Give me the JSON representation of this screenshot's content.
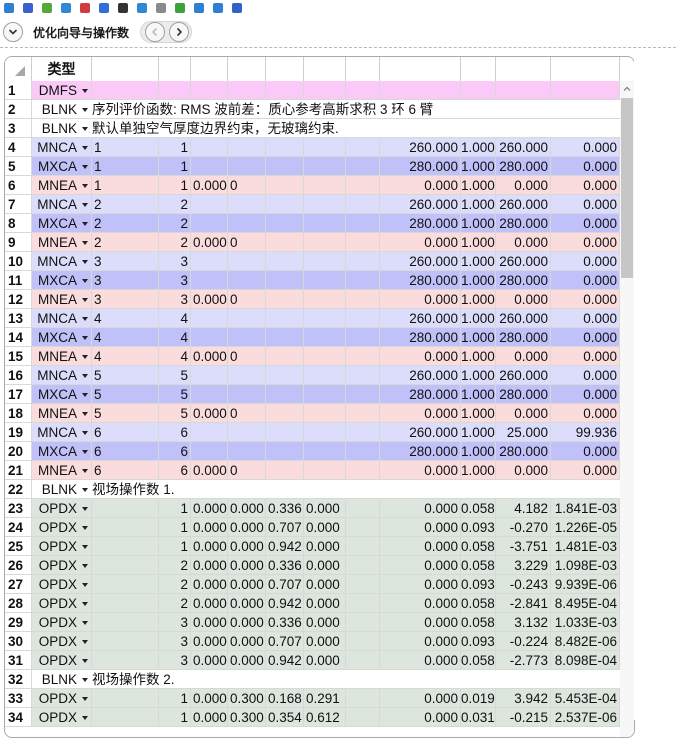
{
  "navbar": {
    "title": "优化向导与操作数"
  },
  "toolbar": {
    "icons": [
      "refresh-icon",
      "save-icon",
      "load-icon",
      "insert-icon",
      "delete-icon",
      "wizard-icon",
      "select-icon",
      "undo-icon",
      "toggle-icon",
      "sort-icon",
      "expand-icon",
      "arrow-icon",
      "help-icon"
    ]
  },
  "grid": {
    "header_type": "类型",
    "colors": {
      "DMFS": "#fbc9f7",
      "BLNK": "#ffffff",
      "MNCA": "#dcdcfb",
      "MXCA": "#c1c1f9",
      "MNEA": "#fadcdc",
      "OPDX": "#dde6dc"
    },
    "rows": [
      {
        "n": "1",
        "type": "DMFS",
        "c": [
          "",
          "",
          "",
          "",
          "",
          "",
          "",
          "",
          "",
          ""
        ]
      },
      {
        "n": "2",
        "type": "BLNK",
        "comment": "序列评价函数: RMS 波前差：质心参考高斯求积 3 环 6 臂"
      },
      {
        "n": "3",
        "type": "BLNK",
        "comment": "默认单独空气厚度边界约束，无玻璃约束."
      },
      {
        "n": "4",
        "type": "MNCA",
        "c": [
          "1",
          "1",
          "",
          "",
          "",
          "",
          "260.000",
          "1.000",
          "260.000",
          "0.000"
        ]
      },
      {
        "n": "5",
        "type": "MXCA",
        "c": [
          "1",
          "1",
          "",
          "",
          "",
          "",
          "280.000",
          "1.000",
          "280.000",
          "0.000"
        ]
      },
      {
        "n": "6",
        "type": "MNEA",
        "c": [
          "1",
          "1",
          "0.000",
          "0",
          "",
          "",
          "0.000",
          "1.000",
          "0.000",
          "0.000"
        ]
      },
      {
        "n": "7",
        "type": "MNCA",
        "c": [
          "2",
          "2",
          "",
          "",
          "",
          "",
          "260.000",
          "1.000",
          "260.000",
          "0.000"
        ]
      },
      {
        "n": "8",
        "type": "MXCA",
        "c": [
          "2",
          "2",
          "",
          "",
          "",
          "",
          "280.000",
          "1.000",
          "280.000",
          "0.000"
        ]
      },
      {
        "n": "9",
        "type": "MNEA",
        "c": [
          "2",
          "2",
          "0.000",
          "0",
          "",
          "",
          "0.000",
          "1.000",
          "0.000",
          "0.000"
        ]
      },
      {
        "n": "10",
        "type": "MNCA",
        "c": [
          "3",
          "3",
          "",
          "",
          "",
          "",
          "260.000",
          "1.000",
          "260.000",
          "0.000"
        ]
      },
      {
        "n": "11",
        "type": "MXCA",
        "c": [
          "3",
          "3",
          "",
          "",
          "",
          "",
          "280.000",
          "1.000",
          "280.000",
          "0.000"
        ]
      },
      {
        "n": "12",
        "type": "MNEA",
        "c": [
          "3",
          "3",
          "0.000",
          "0",
          "",
          "",
          "0.000",
          "1.000",
          "0.000",
          "0.000"
        ]
      },
      {
        "n": "13",
        "type": "MNCA",
        "c": [
          "4",
          "4",
          "",
          "",
          "",
          "",
          "260.000",
          "1.000",
          "260.000",
          "0.000"
        ]
      },
      {
        "n": "14",
        "type": "MXCA",
        "c": [
          "4",
          "4",
          "",
          "",
          "",
          "",
          "280.000",
          "1.000",
          "280.000",
          "0.000"
        ]
      },
      {
        "n": "15",
        "type": "MNEA",
        "c": [
          "4",
          "4",
          "0.000",
          "0",
          "",
          "",
          "0.000",
          "1.000",
          "0.000",
          "0.000"
        ]
      },
      {
        "n": "16",
        "type": "MNCA",
        "c": [
          "5",
          "5",
          "",
          "",
          "",
          "",
          "260.000",
          "1.000",
          "260.000",
          "0.000"
        ]
      },
      {
        "n": "17",
        "type": "MXCA",
        "c": [
          "5",
          "5",
          "",
          "",
          "",
          "",
          "280.000",
          "1.000",
          "280.000",
          "0.000"
        ]
      },
      {
        "n": "18",
        "type": "MNEA",
        "c": [
          "5",
          "5",
          "0.000",
          "0",
          "",
          "",
          "0.000",
          "1.000",
          "0.000",
          "0.000"
        ]
      },
      {
        "n": "19",
        "type": "MNCA",
        "c": [
          "6",
          "6",
          "",
          "",
          "",
          "",
          "260.000",
          "1.000",
          "25.000",
          "99.936"
        ]
      },
      {
        "n": "20",
        "type": "MXCA",
        "c": [
          "6",
          "6",
          "",
          "",
          "",
          "",
          "280.000",
          "1.000",
          "280.000",
          "0.000"
        ]
      },
      {
        "n": "21",
        "type": "MNEA",
        "c": [
          "6",
          "6",
          "0.000",
          "0",
          "",
          "",
          "0.000",
          "1.000",
          "0.000",
          "0.000"
        ]
      },
      {
        "n": "22",
        "type": "BLNK",
        "comment": "视场操作数 1."
      },
      {
        "n": "23",
        "type": "OPDX",
        "c": [
          "",
          "1",
          "0.000",
          "0.000",
          "0.336",
          "0.000",
          "0.000",
          "0.058",
          "4.182",
          "1.841E-03"
        ]
      },
      {
        "n": "24",
        "type": "OPDX",
        "c": [
          "",
          "1",
          "0.000",
          "0.000",
          "0.707",
          "0.000",
          "0.000",
          "0.093",
          "-0.270",
          "1.226E-05"
        ]
      },
      {
        "n": "25",
        "type": "OPDX",
        "c": [
          "",
          "1",
          "0.000",
          "0.000",
          "0.942",
          "0.000",
          "0.000",
          "0.058",
          "-3.751",
          "1.481E-03"
        ]
      },
      {
        "n": "26",
        "type": "OPDX",
        "c": [
          "",
          "2",
          "0.000",
          "0.000",
          "0.336",
          "0.000",
          "0.000",
          "0.058",
          "3.229",
          "1.098E-03"
        ]
      },
      {
        "n": "27",
        "type": "OPDX",
        "c": [
          "",
          "2",
          "0.000",
          "0.000",
          "0.707",
          "0.000",
          "0.000",
          "0.093",
          "-0.243",
          "9.939E-06"
        ]
      },
      {
        "n": "28",
        "type": "OPDX",
        "c": [
          "",
          "2",
          "0.000",
          "0.000",
          "0.942",
          "0.000",
          "0.000",
          "0.058",
          "-2.841",
          "8.495E-04"
        ]
      },
      {
        "n": "29",
        "type": "OPDX",
        "c": [
          "",
          "3",
          "0.000",
          "0.000",
          "0.336",
          "0.000",
          "0.000",
          "0.058",
          "3.132",
          "1.033E-03"
        ]
      },
      {
        "n": "30",
        "type": "OPDX",
        "c": [
          "",
          "3",
          "0.000",
          "0.000",
          "0.707",
          "0.000",
          "0.000",
          "0.093",
          "-0.224",
          "8.482E-06"
        ]
      },
      {
        "n": "31",
        "type": "OPDX",
        "c": [
          "",
          "3",
          "0.000",
          "0.000",
          "0.942",
          "0.000",
          "0.000",
          "0.058",
          "-2.773",
          "8.098E-04"
        ]
      },
      {
        "n": "32",
        "type": "BLNK",
        "comment": "视场操作数 2."
      },
      {
        "n": "33",
        "type": "OPDX",
        "c": [
          "",
          "1",
          "0.000",
          "0.300",
          "0.168",
          "0.291",
          "0.000",
          "0.019",
          "3.942",
          "5.453E-04"
        ]
      },
      {
        "n": "34",
        "type": "OPDX",
        "c": [
          "",
          "1",
          "0.000",
          "0.300",
          "0.354",
          "0.612",
          "0.000",
          "0.031",
          "-0.215",
          "2.537E-06"
        ]
      }
    ]
  }
}
